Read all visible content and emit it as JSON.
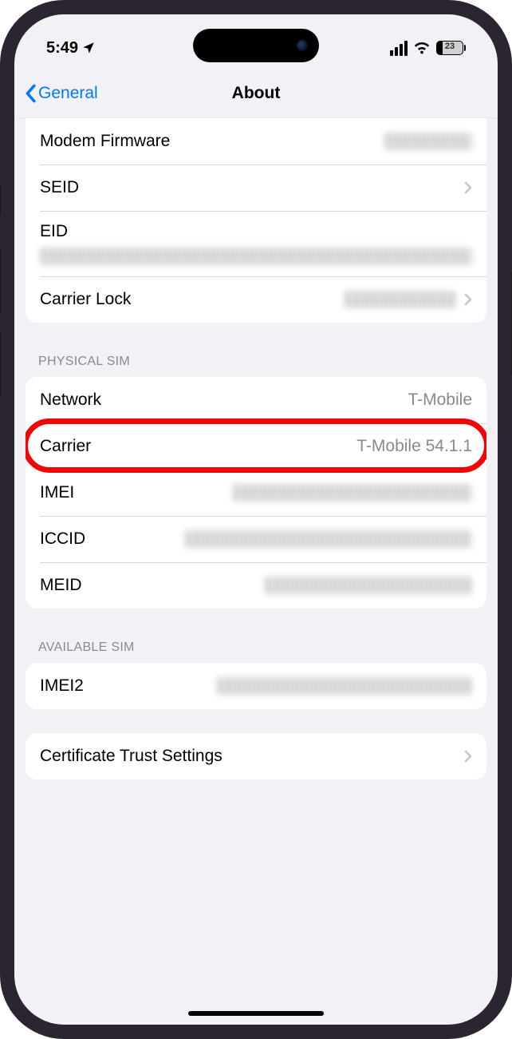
{
  "statusBar": {
    "time": "5:49",
    "batteryPct": "23"
  },
  "nav": {
    "back": "General",
    "title": "About"
  },
  "section1": {
    "modemFirmware": "Modem Firmware",
    "seid": "SEID",
    "eid": "EID",
    "carrierLock": "Carrier Lock"
  },
  "section2": {
    "header": "PHYSICAL SIM",
    "network": {
      "label": "Network",
      "value": "T-Mobile"
    },
    "carrier": {
      "label": "Carrier",
      "value": "T-Mobile 54.1.1"
    },
    "imei": "IMEI",
    "iccid": "ICCID",
    "meid": "MEID"
  },
  "section3": {
    "header": "AVAILABLE SIM",
    "imei2": "IMEI2"
  },
  "section4": {
    "cert": "Certificate Trust Settings"
  }
}
